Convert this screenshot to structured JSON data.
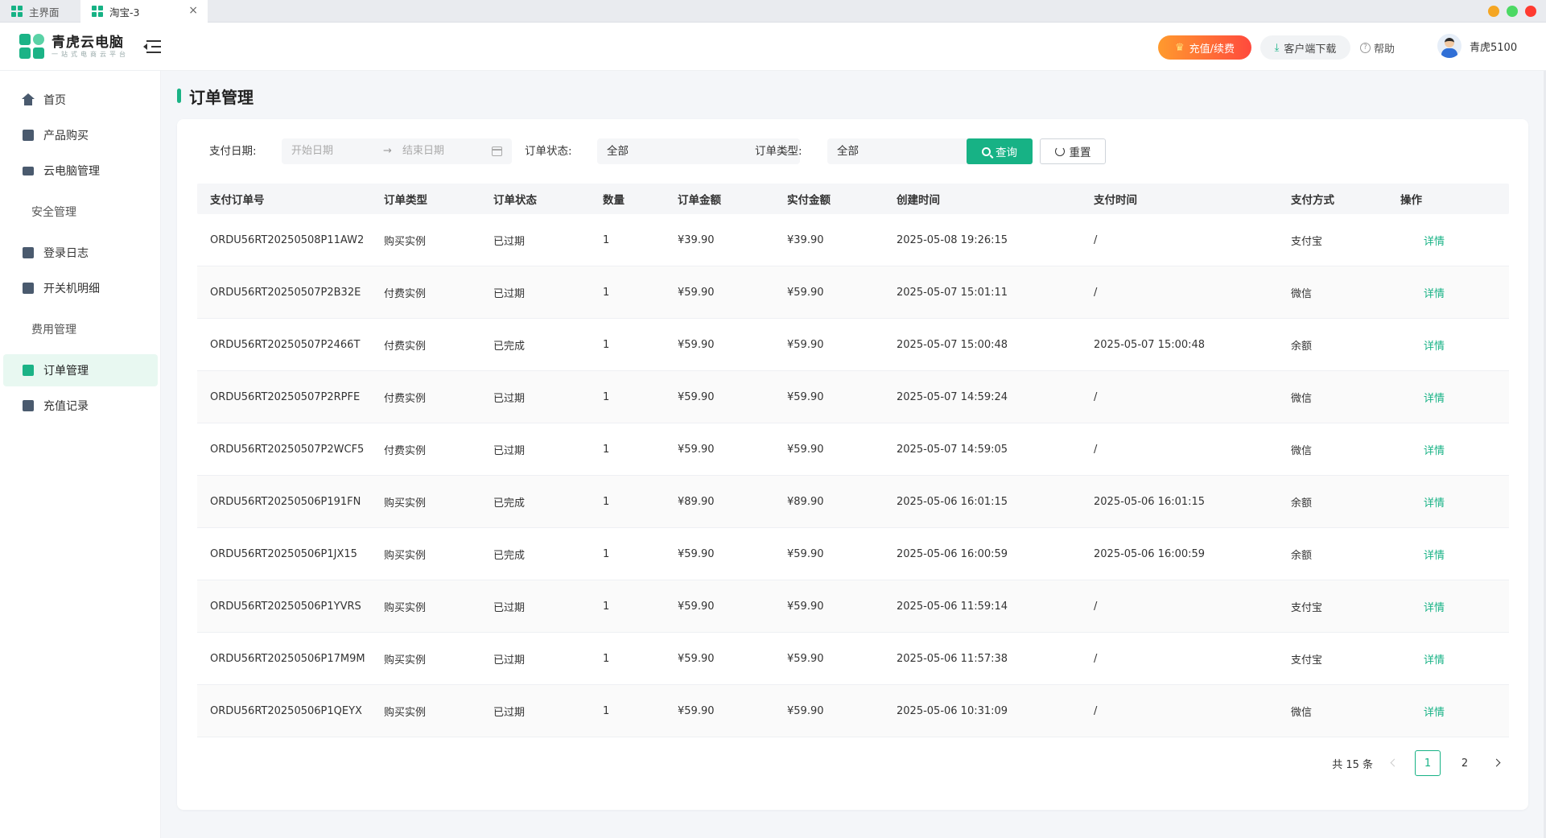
{
  "browser_tabs": [
    {
      "label": "主界面"
    },
    {
      "label": "淘宝-3",
      "close": "×"
    }
  ],
  "window_controls": {
    "colors": [
      "#f5a623",
      "#4cd964",
      "#ff3b30"
    ]
  },
  "header": {
    "logo_name": "青虎云电脑",
    "logo_slogan": "一站式电商云平台",
    "recharge_label": "充值/续费",
    "download_label": "客户端下载",
    "help_label": "帮助",
    "username": "青虎5100"
  },
  "sidebar": {
    "items": [
      {
        "label": "首页"
      },
      {
        "label": "产品购买"
      },
      {
        "label": "云电脑管理"
      },
      {
        "label": "安全管理"
      },
      {
        "label": "登录日志"
      },
      {
        "label": "开关机明细"
      },
      {
        "label": "费用管理"
      },
      {
        "label": "订单管理"
      },
      {
        "label": "充值记录"
      }
    ]
  },
  "page": {
    "title": "订单管理"
  },
  "filters": {
    "pay_date_label": "支付日期:",
    "start_placeholder": "开始日期",
    "arrow": "→",
    "end_placeholder": "结束日期",
    "status_label": "订单状态:",
    "status_value": "全部",
    "type_label": "订单类型:",
    "type_value": "全部",
    "query_label": "查询",
    "reset_label": "重置"
  },
  "table": {
    "headers": [
      "支付订单号",
      "订单类型",
      "订单状态",
      "数量",
      "订单金额",
      "实付金额",
      "创建时间",
      "支付时间",
      "支付方式",
      "操作"
    ],
    "rows": [
      [
        "ORDU56RT20250508P11AW2",
        "购买实例",
        "已过期",
        "1",
        "¥39.90",
        "¥39.90",
        "2025-05-08 19:26:15",
        "/",
        "支付宝",
        "详情"
      ],
      [
        "ORDU56RT20250507P2B32E",
        "付费实例",
        "已过期",
        "1",
        "¥59.90",
        "¥59.90",
        "2025-05-07 15:01:11",
        "/",
        "微信",
        "详情"
      ],
      [
        "ORDU56RT20250507P2466T",
        "付费实例",
        "已完成",
        "1",
        "¥59.90",
        "¥59.90",
        "2025-05-07 15:00:48",
        "2025-05-07 15:00:48",
        "余额",
        "详情"
      ],
      [
        "ORDU56RT20250507P2RPFE",
        "付费实例",
        "已过期",
        "1",
        "¥59.90",
        "¥59.90",
        "2025-05-07 14:59:24",
        "/",
        "微信",
        "详情"
      ],
      [
        "ORDU56RT20250507P2WCF5",
        "付费实例",
        "已过期",
        "1",
        "¥59.90",
        "¥59.90",
        "2025-05-07 14:59:05",
        "/",
        "微信",
        "详情"
      ],
      [
        "ORDU56RT20250506P191FN",
        "购买实例",
        "已完成",
        "1",
        "¥89.90",
        "¥89.90",
        "2025-05-06 16:01:15",
        "2025-05-06 16:01:15",
        "余额",
        "详情"
      ],
      [
        "ORDU56RT20250506P1JX15",
        "购买实例",
        "已完成",
        "1",
        "¥59.90",
        "¥59.90",
        "2025-05-06 16:00:59",
        "2025-05-06 16:00:59",
        "余额",
        "详情"
      ],
      [
        "ORDU56RT20250506P1YVRS",
        "购买实例",
        "已过期",
        "1",
        "¥59.90",
        "¥59.90",
        "2025-05-06 11:59:14",
        "/",
        "支付宝",
        "详情"
      ],
      [
        "ORDU56RT20250506P17M9M",
        "购买实例",
        "已过期",
        "1",
        "¥59.90",
        "¥59.90",
        "2025-05-06 11:57:38",
        "/",
        "支付宝",
        "详情"
      ],
      [
        "ORDU56RT20250506P1QEYX",
        "购买实例",
        "已过期",
        "1",
        "¥59.90",
        "¥59.90",
        "2025-05-06 10:31:09",
        "/",
        "微信",
        "详情"
      ]
    ]
  },
  "pagination": {
    "total": "共 15 条",
    "pages": [
      "1",
      "2"
    ],
    "current": "1"
  },
  "colors": {
    "accent": "#17b285",
    "recharge_start": "#ff9a2e",
    "recharge_end": "#ff4a3d",
    "active_bg": "#e8f8f1"
  }
}
